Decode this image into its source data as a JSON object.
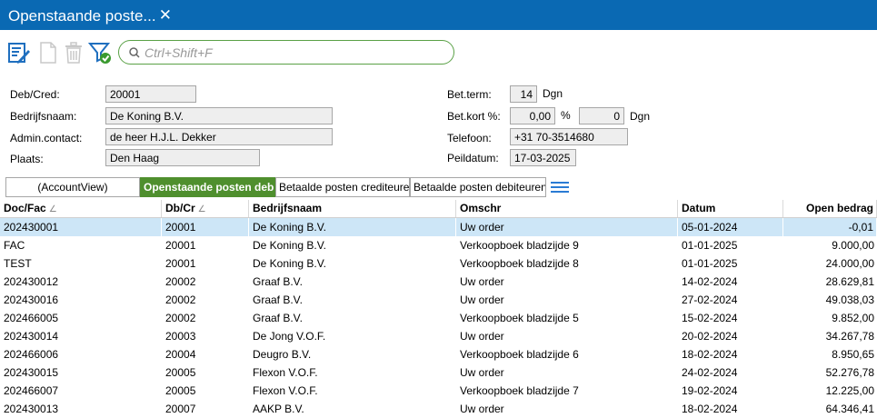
{
  "window": {
    "tab_title": "Openstaande poste...",
    "close_glyph": "✕"
  },
  "toolbar": {
    "icons": [
      "edit-icon",
      "new-document-icon",
      "delete-icon",
      "filter-icon"
    ],
    "search_placeholder": "Ctrl+Shift+F"
  },
  "form": {
    "deb_cred_label": "Deb/Cred:",
    "deb_cred_value": "20001",
    "company_label": "Bedrijfsnaam:",
    "company_value": "De Koning B.V.",
    "contact_label": "Admin.contact:",
    "contact_value": "de heer H.J.L. Dekker",
    "place_label": "Plaats:",
    "place_value": "Den Haag",
    "payterm_label": "Bet.term:",
    "payterm_value": "14",
    "payterm_unit": "Dgn",
    "discount_label": "Bet.kort %:",
    "discount_value": "0,00",
    "discount_pct_unit": "%",
    "discount_days_value": "0",
    "discount_days_unit": "Dgn",
    "phone_label": "Telefoon:",
    "phone_value": "+31 70-3514680",
    "refdate_label": "Peildatum:",
    "refdate_value": "17-03-2025"
  },
  "view_tabs": [
    {
      "label": "(AccountView)",
      "active": false
    },
    {
      "label": "Openstaande posten debiteuren",
      "active": true
    },
    {
      "label": "Betaalde posten crediteuren",
      "active": false
    },
    {
      "label": "Betaalde posten debiteuren",
      "active": false
    }
  ],
  "grid": {
    "columns": [
      {
        "label": "Doc/Fac",
        "sort": "∠"
      },
      {
        "label": "Db/Cr",
        "sort": "∠"
      },
      {
        "label": "Bedrijfsnaam",
        "sort": ""
      },
      {
        "label": "Omschr",
        "sort": ""
      },
      {
        "label": "Datum",
        "sort": ""
      },
      {
        "label": "Open bedrag",
        "sort": ""
      }
    ],
    "rows": [
      [
        "202430001",
        "20001",
        "De Koning B.V.",
        "Uw order",
        "05-01-2024",
        "-0,01"
      ],
      [
        "FAC",
        "20001",
        "De Koning B.V.",
        "Verkoopboek bladzijde 9",
        "01-01-2025",
        "9.000,00"
      ],
      [
        "TEST",
        "20001",
        "De Koning B.V.",
        "Verkoopboek bladzijde 8",
        "01-01-2025",
        "24.000,00"
      ],
      [
        "202430012",
        "20002",
        "Graaf B.V.",
        "Uw order",
        "14-02-2024",
        "28.629,81"
      ],
      [
        "202430016",
        "20002",
        "Graaf B.V.",
        "Uw order",
        "27-02-2024",
        "49.038,03"
      ],
      [
        "202466005",
        "20002",
        "Graaf B.V.",
        "Verkoopboek bladzijde 5",
        "15-02-2024",
        "9.852,00"
      ],
      [
        "202430014",
        "20003",
        "De Jong V.O.F.",
        "Uw order",
        "20-02-2024",
        "34.267,78"
      ],
      [
        "202466006",
        "20004",
        "Deugro B.V.",
        "Verkoopboek bladzijde 6",
        "18-02-2024",
        "8.950,65"
      ],
      [
        "202430015",
        "20005",
        "Flexon V.O.F.",
        "Uw order",
        "24-02-2024",
        "52.276,78"
      ],
      [
        "202466007",
        "20005",
        "Flexon V.O.F.",
        "Verkoopboek bladzijde 7",
        "19-02-2024",
        "12.225,00"
      ],
      [
        "202430013",
        "20007",
        "AAKP B.V.",
        "Uw order",
        "18-02-2024",
        "64.346,41"
      ]
    ],
    "selected_row": 0
  }
}
